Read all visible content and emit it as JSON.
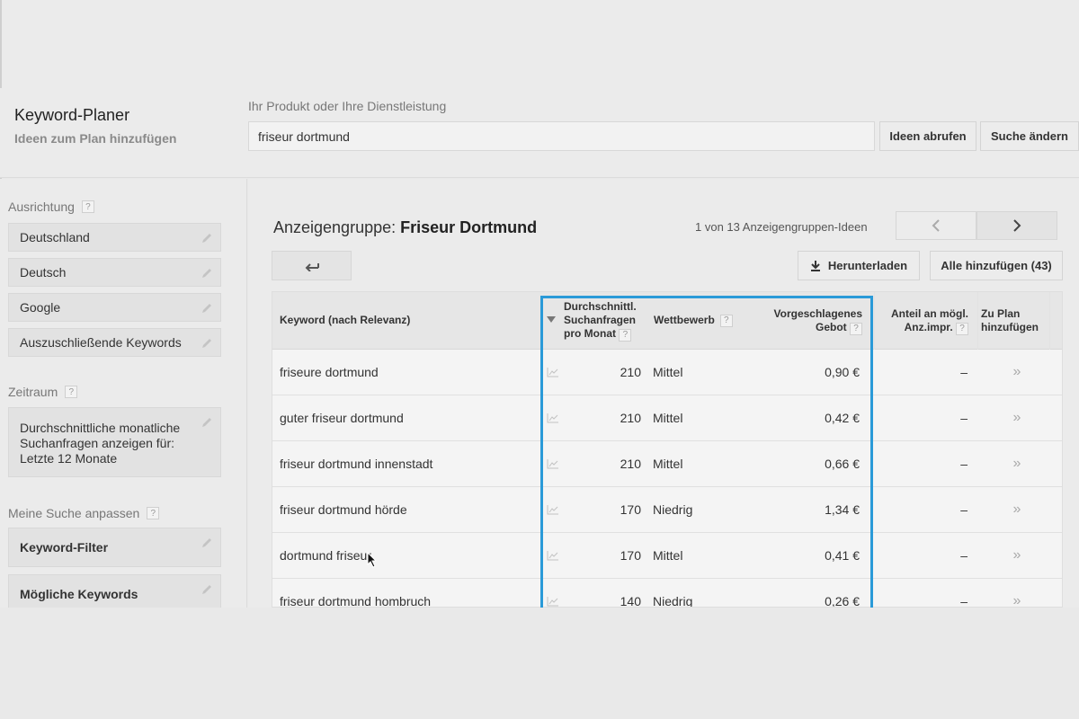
{
  "header": {
    "title": "Keyword-Planer",
    "subtitle": "Ideen zum Plan hinzufügen",
    "search_label": "Ihr Produkt oder Ihre Dienstleistung",
    "search_value": "friseur dortmund",
    "ideas_button": "Ideen abrufen",
    "change_button": "Suche ändern"
  },
  "sidebar": {
    "targeting_title": "Ausrichtung",
    "targeting_items": [
      {
        "label": "Deutschland"
      },
      {
        "label": "Deutsch"
      },
      {
        "label": "Google"
      },
      {
        "label": "Auszuschließende Keywords"
      }
    ],
    "period_title": "Zeitraum",
    "period_text": "Durchschnittliche monatliche Suchanfragen anzeigen für: Letzte 12 Monate",
    "customize_title": "Meine Suche anpassen",
    "customize_items": [
      {
        "label": "Keyword-Filter"
      },
      {
        "label": "Mögliche Keywords"
      }
    ],
    "help_mark": "?"
  },
  "main": {
    "group_prefix": "Anzeigengruppe:",
    "group_name": "Friseur Dortmund",
    "pager_text": "1 von 13 Anzeigengruppen-Ideen",
    "download_button": "Herunterladen",
    "add_all_button": "Alle hinzufügen (43)"
  },
  "table": {
    "headers": {
      "keyword": "Keyword (nach Relevanz)",
      "searches_1": "Durchschnittl.",
      "searches_2": "Suchanfragen",
      "searches_3": "pro Monat",
      "competition": "Wettbewerb",
      "bid_1": "Vorgeschlagenes",
      "bid_2": "Gebot",
      "share_1": "Anteil an mögl.",
      "share_2": "Anz.impr.",
      "add_1": "Zu Plan",
      "add_2": "hinzufügen"
    },
    "rows": [
      {
        "keyword": "friseure dortmund",
        "searches": "210",
        "competition": "Mittel",
        "bid": "0,90 €",
        "share": "–",
        "add": "»"
      },
      {
        "keyword": "guter friseur dortmund",
        "searches": "210",
        "competition": "Mittel",
        "bid": "0,42 €",
        "share": "–",
        "add": "»"
      },
      {
        "keyword": "friseur dortmund innenstadt",
        "searches": "210",
        "competition": "Mittel",
        "bid": "0,66 €",
        "share": "–",
        "add": "»"
      },
      {
        "keyword": "friseur dortmund hörde",
        "searches": "170",
        "competition": "Niedrig",
        "bid": "1,34 €",
        "share": "–",
        "add": "»"
      },
      {
        "keyword": "dortmund friseur",
        "searches": "170",
        "competition": "Mittel",
        "bid": "0,41 €",
        "share": "–",
        "add": "»"
      },
      {
        "keyword": "friseur dortmund hombruch",
        "searches": "140",
        "competition": "Niedrig",
        "bid": "0,26 €",
        "share": "–",
        "add": "»"
      }
    ]
  },
  "colors": {
    "highlight": "#2a9ad8",
    "background": "#ebebeb"
  }
}
